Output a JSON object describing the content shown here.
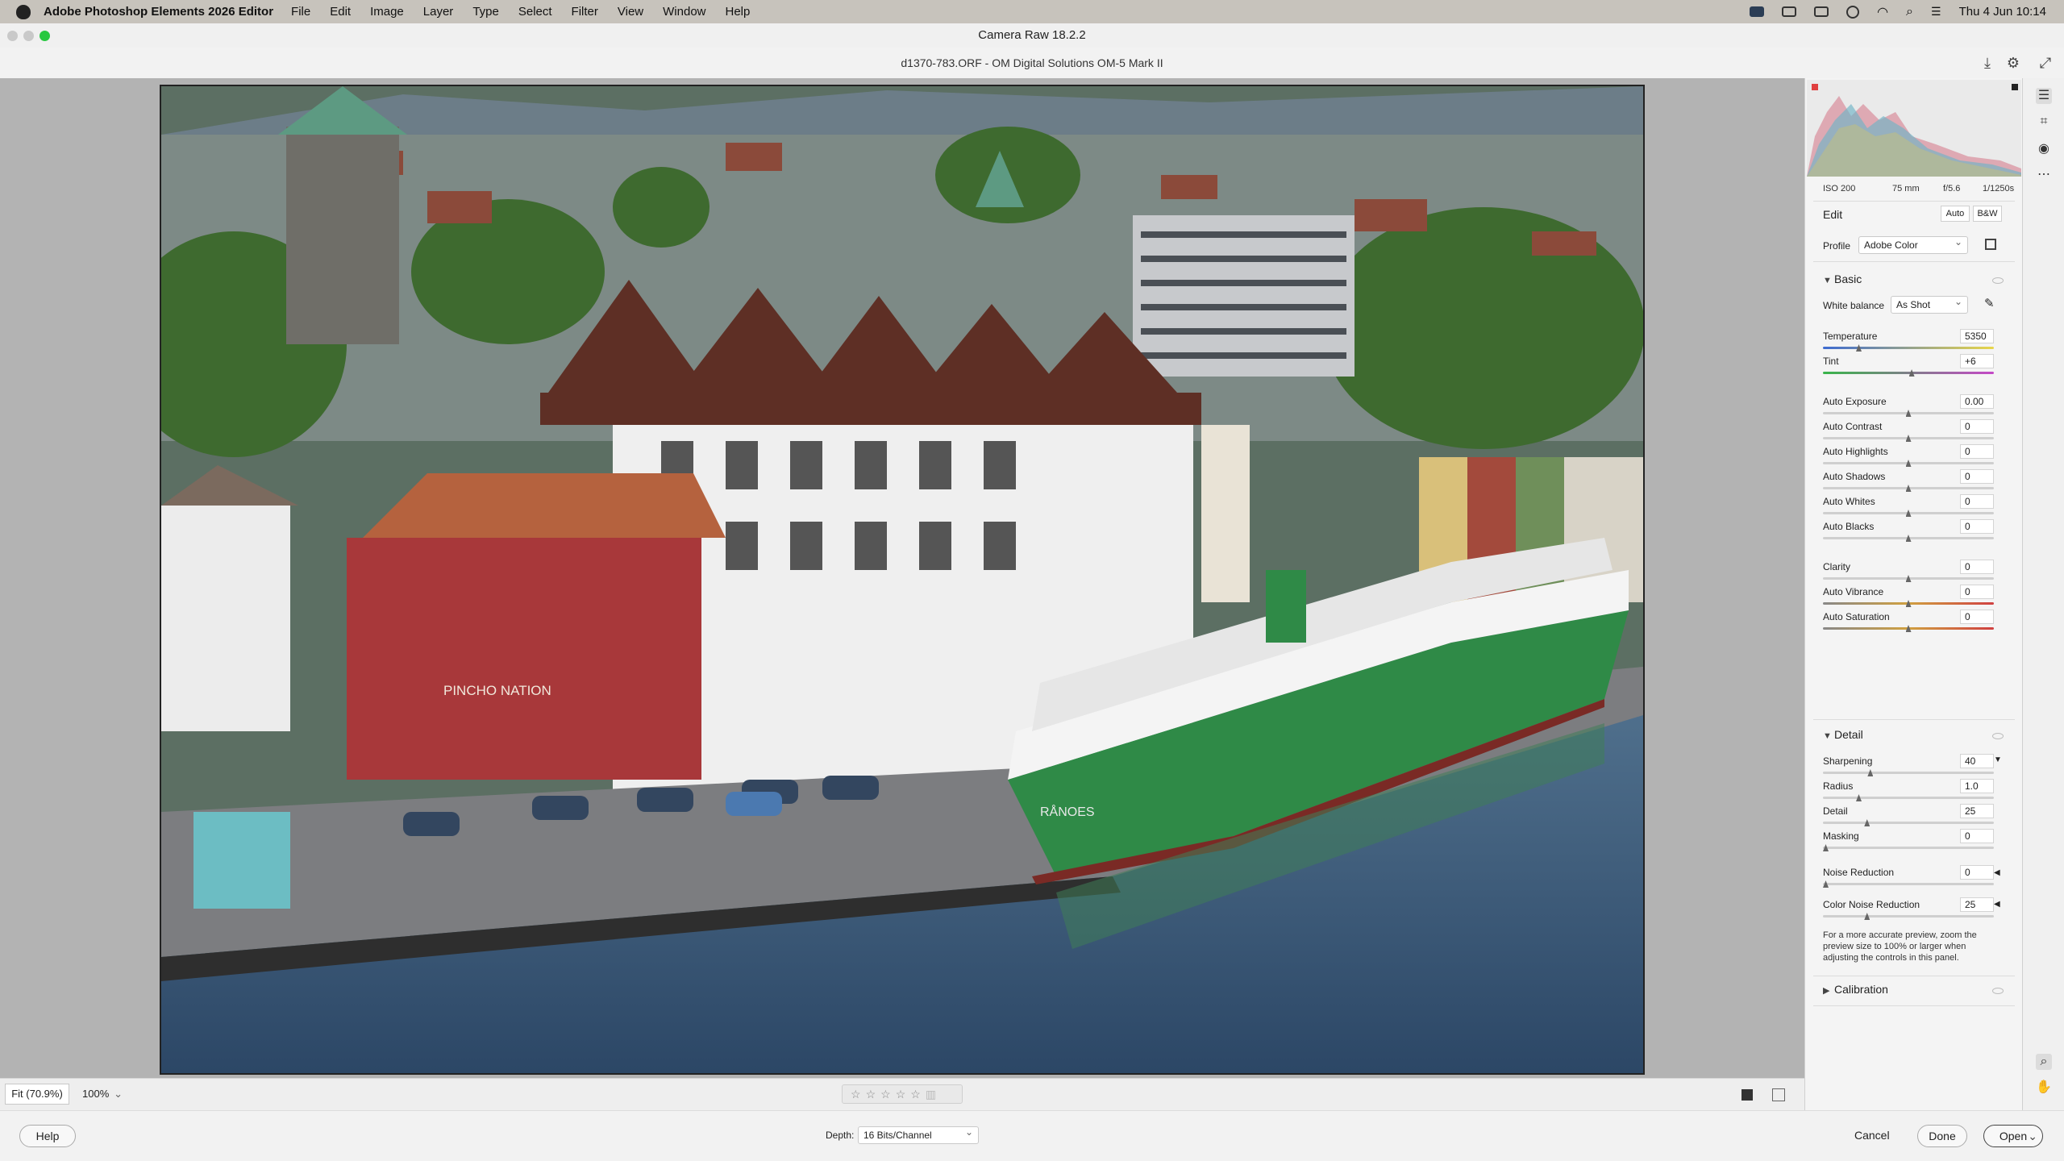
{
  "menubar": {
    "app_name": "Adobe Photoshop Elements 2026 Editor",
    "items": [
      "File",
      "Edit",
      "Image",
      "Layer",
      "Type",
      "Select",
      "Filter",
      "View",
      "Window",
      "Help"
    ],
    "datetime": "Thu 4 Jun  10:14"
  },
  "window": {
    "title": "Camera Raw 18.2.2",
    "file_info": "d1370-783.ORF  -  OM Digital Solutions OM-5 Mark II"
  },
  "photo": {
    "sign_text": "PINCHO NATION",
    "ship_name": "RÅNOES"
  },
  "histogram": {
    "iso": "ISO 200",
    "focal": "75 mm",
    "aperture": "f/5.6",
    "shutter": "1/1250s"
  },
  "edit": {
    "title": "Edit",
    "auto_label": "Auto",
    "bw_label": "B&W",
    "profile_label": "Profile",
    "profile_value": "Adobe Color"
  },
  "basic": {
    "title": "Basic",
    "wb_label": "White balance",
    "wb_value": "As Shot",
    "sliders": [
      {
        "label": "Temperature",
        "value": "5350",
        "pos": 0.2
      },
      {
        "label": "Tint",
        "value": "+6",
        "pos": 0.52
      },
      {
        "label": "Auto Exposure",
        "value": "0.00",
        "pos": 0.5
      },
      {
        "label": "Auto Contrast",
        "value": "0",
        "pos": 0.5
      },
      {
        "label": "Auto Highlights",
        "value": "0",
        "pos": 0.5
      },
      {
        "label": "Auto Shadows",
        "value": "0",
        "pos": 0.5
      },
      {
        "label": "Auto Whites",
        "value": "0",
        "pos": 0.5
      },
      {
        "label": "Auto Blacks",
        "value": "0",
        "pos": 0.5
      },
      {
        "label": "Clarity",
        "value": "0",
        "pos": 0.5
      },
      {
        "label": "Auto Vibrance",
        "value": "0",
        "pos": 0.5
      },
      {
        "label": "Auto Saturation",
        "value": "0",
        "pos": 0.5
      }
    ]
  },
  "detail": {
    "title": "Detail",
    "sliders": [
      {
        "label": "Sharpening",
        "value": "40",
        "pos": 0.27
      },
      {
        "label": "Radius",
        "value": "1.0",
        "pos": 0.2
      },
      {
        "label": "Detail",
        "value": "25",
        "pos": 0.25
      },
      {
        "label": "Masking",
        "value": "0",
        "pos": 0.0
      },
      {
        "label": "Noise Reduction",
        "value": "0",
        "pos": 0.0
      },
      {
        "label": "Color Noise Reduction",
        "value": "25",
        "pos": 0.25
      }
    ],
    "note": "For a more accurate preview, zoom the preview size to 100% or larger when adjusting the controls in this panel."
  },
  "calibration": {
    "title": "Calibration"
  },
  "viewbar": {
    "fit_label": "Fit (70.9%)",
    "zoom_label": "100%"
  },
  "footer": {
    "help": "Help",
    "depth_label": "Depth:",
    "depth_value": "16 Bits/Channel",
    "cancel": "Cancel",
    "done": "Done",
    "open": "Open"
  },
  "colors": {
    "hull_green": "#2f8a47",
    "brick_red": "#a8383a",
    "roof_brown": "#6e3b2c",
    "water": "#3b5a78"
  }
}
